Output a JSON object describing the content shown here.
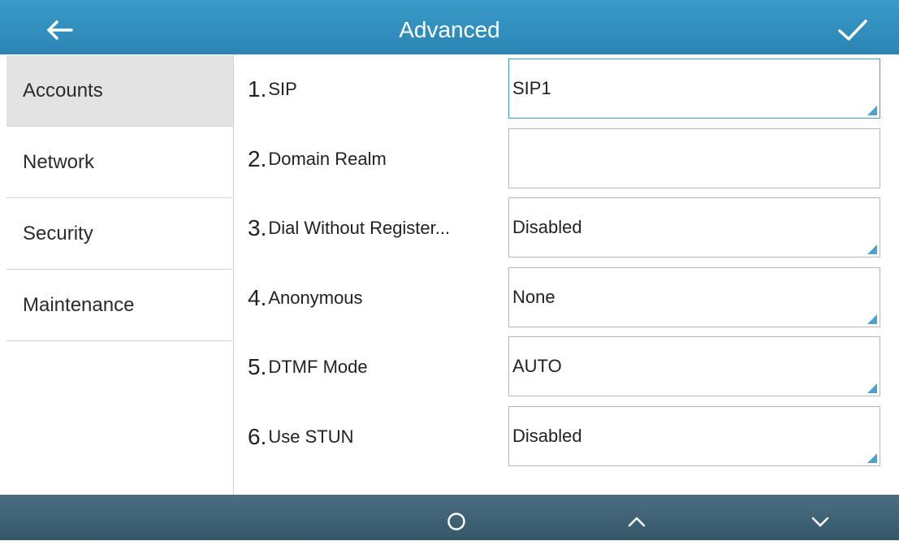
{
  "header": {
    "title": "Advanced",
    "back_icon": "arrow-left-icon",
    "confirm_icon": "checkmark-icon"
  },
  "sidebar": {
    "items": [
      {
        "label": "Accounts",
        "active": true
      },
      {
        "label": "Network",
        "active": false
      },
      {
        "label": "Security",
        "active": false
      },
      {
        "label": "Maintenance",
        "active": false
      }
    ]
  },
  "settings": [
    {
      "num": "1.",
      "label": "SIP",
      "value": "SIP1",
      "type": "select"
    },
    {
      "num": "2.",
      "label": "Domain Realm",
      "value": "",
      "type": "text"
    },
    {
      "num": "3.",
      "label": "Dial Without Register...",
      "value": "Disabled",
      "type": "select"
    },
    {
      "num": "4.",
      "label": "Anonymous",
      "value": "None",
      "type": "select"
    },
    {
      "num": "5.",
      "label": "DTMF Mode",
      "value": "AUTO",
      "type": "select"
    },
    {
      "num": "6.",
      "label": "Use STUN",
      "value": "Disabled",
      "type": "select"
    }
  ],
  "footer": {
    "buttons": [
      "circle-icon",
      "chevron-up-icon",
      "chevron-down-icon"
    ]
  },
  "colors": {
    "header": "#2f8fbf",
    "footer": "#3f6274",
    "active_sidebar": "#e3e3e3",
    "focus_border": "#39a0cf"
  }
}
